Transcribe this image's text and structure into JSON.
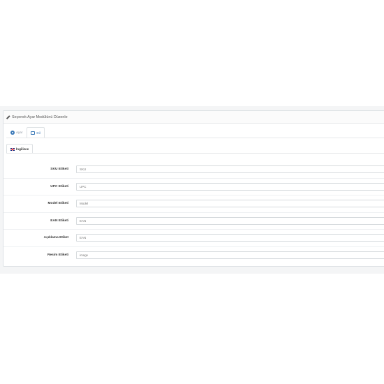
{
  "panel": {
    "title": "Seçenek Ayar Modülünü Düzenle"
  },
  "tabs": [
    {
      "label": "Ayar",
      "icon": "gear-icon",
      "active": false
    },
    {
      "label": "Dil",
      "icon": "flag-icon",
      "active": true
    }
  ],
  "language_tab": {
    "label": "İngilizce",
    "icon": "uk-flag-icon"
  },
  "fields": [
    {
      "label": "SKU Etiketi",
      "value": "SKU"
    },
    {
      "label": "UPC Etiketi",
      "value": "UPC"
    },
    {
      "label": "Model Etiketi",
      "value": "Model"
    },
    {
      "label": "EAN Etiketi",
      "value": "EAN"
    },
    {
      "label": "Açıklama Etiket",
      "value": "EAN"
    },
    {
      "label": "Resim Etiketi",
      "value": "image"
    }
  ]
}
